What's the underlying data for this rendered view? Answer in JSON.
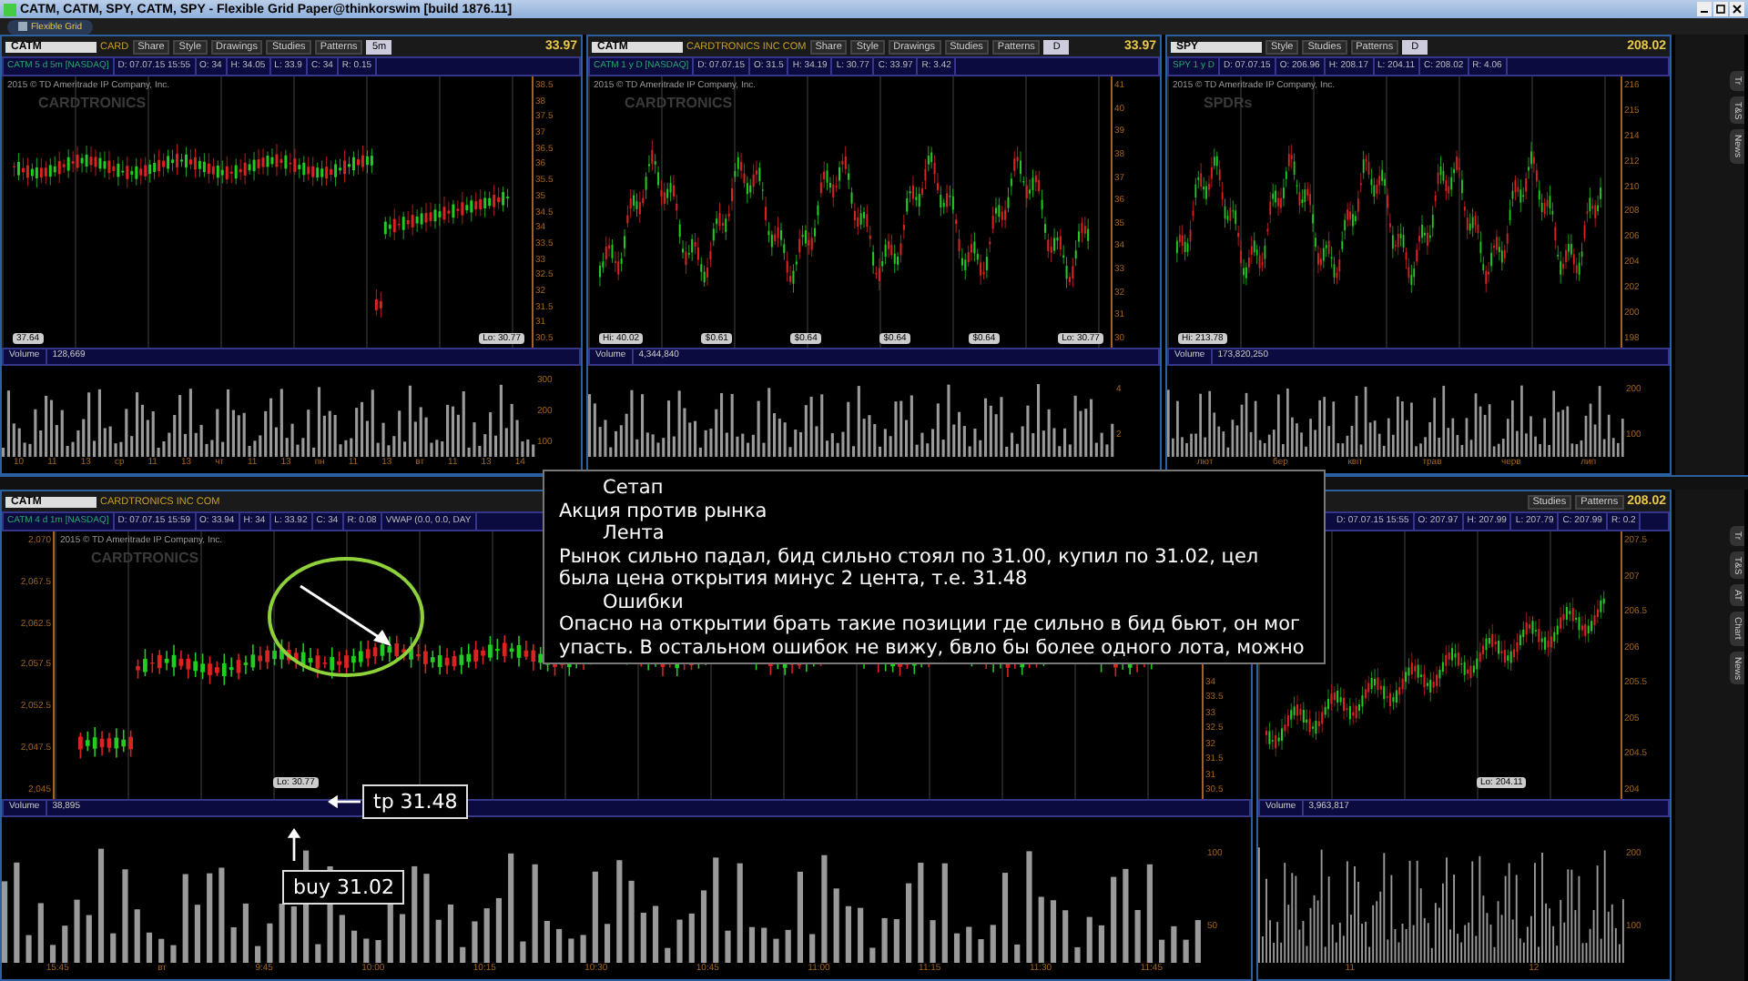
{
  "window": {
    "title": "CATM, CATM, SPY, CATM, SPY - Flexible Grid Paper@thinkorswim [build 1876.11]"
  },
  "grid_button": "Flexible Grid",
  "top_panels": [
    {
      "symbol": "CATM",
      "company": "CARD",
      "buttons": [
        "Share",
        "Style",
        "Drawings",
        "Studies",
        "Patterns"
      ],
      "period": "5m",
      "price": "33.97",
      "info": [
        "CATM 5 d 5m [NASDAQ]",
        "D: 07.07.15 15:55",
        "O: 34",
        "H: 34.05",
        "L: 33.9",
        "C: 34",
        "R: 0.15"
      ],
      "copyright": "2015 © TD Ameritrade IP Company, Inc.",
      "logo": "CARDTRONICS",
      "axis": [
        "38.5",
        "38",
        "37.5",
        "37",
        "36.5",
        "36",
        "35.5",
        "35",
        "34.5",
        "34",
        "33.5",
        "33",
        "32.5",
        "32",
        "31.5",
        "31",
        "30.5"
      ],
      "marks": [
        "37.64",
        "Lo: 30.77"
      ],
      "volume_label": "Volume",
      "volume": "128,669",
      "volume_axis": [
        "300",
        "200",
        "100"
      ],
      "times": [
        "10",
        "11",
        "13",
        "ср",
        "11",
        "13",
        "чт",
        "11",
        "13",
        "пн",
        "11",
        "13",
        "вт",
        "11",
        "13",
        "14"
      ]
    },
    {
      "symbol": "CATM",
      "company": "CARDTRONICS INC COM",
      "buttons": [
        "Share",
        "Style",
        "Drawings",
        "Studies",
        "Patterns"
      ],
      "period": "D",
      "price": "33.97",
      "info": [
        "CATM 1 y D [NASDAQ]",
        "D: 07.07.15",
        "O: 31.5",
        "H: 34.19",
        "L: 30.77",
        "C: 33.97",
        "R: 3.42"
      ],
      "copyright": "2015 © TD Ameritrade IP Company, Inc.",
      "logo": "CARDTRONICS",
      "axis": [
        "41",
        "40",
        "39",
        "38",
        "37",
        "36",
        "35",
        "34",
        "33",
        "32",
        "31",
        "30"
      ],
      "marks": [
        "Hi: 40.02",
        "$0.61",
        "$0.64",
        "$0.64",
        "$0.64",
        "Lo: 30.77"
      ],
      "volume_label": "Volume",
      "volume": "4,344,840",
      "volume_axis": [
        "4",
        "2"
      ]
    },
    {
      "symbol": "SPY",
      "buttons": [
        "Style",
        "Studies",
        "Patterns"
      ],
      "period": "D",
      "price": "208.02",
      "info": [
        "SPY 1 y D",
        "D: 07.07.15",
        "O: 206.96",
        "H: 208.17",
        "L: 204.11",
        "C: 208.02",
        "R: 4.06"
      ],
      "copyright": "2015 © TD Ameritrade IP Company, Inc.",
      "logo": "SPDRs",
      "axis": [
        "216",
        "215",
        "214",
        "212",
        "210",
        "208",
        "206",
        "204",
        "202",
        "200",
        "198"
      ],
      "marks": [
        "Hi: 213.78"
      ],
      "volume_label": "Volume",
      "volume": "173,820,250",
      "volume_axis": [
        "200",
        "100"
      ],
      "times": [
        "лют",
        "бер",
        "квіт",
        "трав",
        "черв",
        "лип"
      ]
    }
  ],
  "bottom_panels": [
    {
      "symbol": "CATM",
      "company": "CARDTRONICS INC COM",
      "info": [
        "CATM 4 d 1m [NASDAQ]",
        "D: 07.07.15 15:59",
        "O: 33.94",
        "H: 34",
        "L: 33.92",
        "C: 34",
        "R: 0.08",
        "VWAP (0.0, 0.0, DAY"
      ],
      "copyright": "2015 © TD Ameritrade IP Company, Inc.",
      "logo": "CARDTRONICS",
      "left_axis": [
        "2,070",
        "2,067.5",
        "2,062.5",
        "2,057.5",
        "2,052.5",
        "2,047.5",
        "2,045"
      ],
      "axis": [
        "34",
        "33.5",
        "33",
        "32.5",
        "32",
        "31.5",
        "31",
        "30.5"
      ],
      "marks": [
        "Lo: 30.77"
      ],
      "volume_label": "Volume",
      "volume": "38,895",
      "volume_axis": [
        "100",
        "50"
      ],
      "times": [
        "15:45",
        "вт",
        "9:45",
        "10:00",
        "10:15",
        "10:30",
        "10:45",
        "11:00",
        "11:15",
        "11:30",
        "11:45"
      ]
    },
    {
      "buttons": [
        "Studies",
        "Patterns"
      ],
      "price": "208.02",
      "info": [
        "D: 07.07.15 15:55",
        "O: 207.97",
        "H: 207.99",
        "L: 207.79",
        "C: 207.99",
        "R: 0.2"
      ],
      "axis": [
        "207.5",
        "207",
        "206.5",
        "206",
        "205.5",
        "205",
        "204.5",
        "204"
      ],
      "marks": [
        "Lo: 204.11"
      ],
      "volume_label": "Volume",
      "volume": "3,963,817",
      "volume_axis": [
        "200",
        "100"
      ],
      "times": [
        "11",
        "12"
      ]
    }
  ],
  "side_tabs_top": [
    "Tr",
    "T&S",
    "News"
  ],
  "side_tabs_bottom": [
    "Tr",
    "T&S",
    "AT",
    "Chart",
    "News"
  ],
  "note": [
    {
      "kind": "heading",
      "text": "Сетап"
    },
    {
      "kind": "body",
      "text": "Акция против рынка"
    },
    {
      "kind": "heading",
      "text": "Лента"
    },
    {
      "kind": "body",
      "text": "Рынок сильно падал, бид сильно стоял по 31.00, купил по 31.02, цел была цена открытия минус 2 цента, т.е. 31.48"
    },
    {
      "kind": "heading",
      "text": "Ошибки"
    },
    {
      "kind": "body",
      "text": "Опасно на открытии брать такие позиции где сильно в бид бьют, он мог упасть. В остальном ошибок не вижу, бвло бы более одного лота, можно"
    }
  ],
  "callouts": [
    "tp 31.48",
    "buy 31.02"
  ]
}
